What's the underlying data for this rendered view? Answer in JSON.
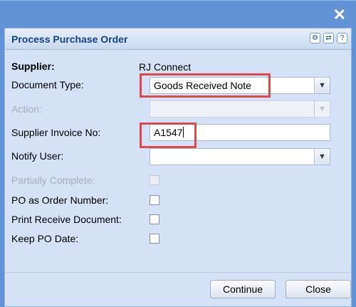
{
  "window": {
    "close_symbol": "✕",
    "title": "Process Purchase Order"
  },
  "toolbar_icons": [
    "gear-icon",
    "refresh-icon",
    "help-icon"
  ],
  "form": {
    "supplier_label": "Supplier:",
    "supplier_value": "RJ Connect",
    "document_type_label": "Document Type:",
    "document_type_value": "Goods Received Note",
    "action_label": "Action:",
    "action_value": "",
    "supplier_invoice_label": "Supplier Invoice No:",
    "supplier_invoice_value": "A1547",
    "notify_user_label": "Notify User:",
    "notify_user_value": "",
    "partially_complete_label": "Partially Complete:",
    "po_as_order_label": "PO as Order Number:",
    "print_receive_label": "Print Receive Document:",
    "keep_po_date_label": "Keep PO Date:"
  },
  "checkboxes": {
    "partially_complete": false,
    "po_as_order": false,
    "print_receive": false,
    "keep_po_date": false
  },
  "buttons": {
    "continue_label": "Continue",
    "close_label": "Close"
  },
  "colors": {
    "window_blue": "#6193d6",
    "panel_bg": "#d5e1f7",
    "title_text": "#15428b",
    "highlight_red": "#e0474b"
  }
}
